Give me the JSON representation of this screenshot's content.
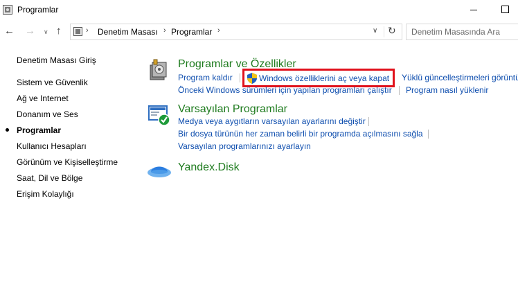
{
  "window": {
    "title": "Programlar"
  },
  "address": {
    "breadcrumbs": [
      "Denetim Masası",
      "Programlar"
    ],
    "search_placeholder": "Denetim Masasında Ara"
  },
  "sidebar": {
    "items": [
      {
        "label": "Denetim Masası Giriş",
        "active": false
      },
      {
        "label": "Sistem ve Güvenlik",
        "active": false
      },
      {
        "label": "Ağ ve Internet",
        "active": false
      },
      {
        "label": "Donanım ve Ses",
        "active": false
      },
      {
        "label": "Programlar",
        "active": true
      },
      {
        "label": "Kullanıcı Hesapları",
        "active": false
      },
      {
        "label": "Görünüm ve Kişiselleştirme",
        "active": false
      },
      {
        "label": "Saat, Dil ve Bölge",
        "active": false
      },
      {
        "label": "Erişim Kolaylığı",
        "active": false
      }
    ]
  },
  "categories": {
    "programs_features": {
      "title": "Programlar ve Özellikler",
      "links": {
        "uninstall": "Program kaldır",
        "windows_features": "Windows özelliklerini aç veya kapat",
        "installed_updates": "Yüklü güncelleştirmeleri görüntü",
        "older_programs": "Önceki Windows sürümleri için yapılan programları çalıştır",
        "how_to_install": "Program nasıl yüklenir"
      }
    },
    "default_programs": {
      "title": "Varsayılan Programlar",
      "links": {
        "media_autoplay": "Medya veya aygıtların varsayılan ayarlarını değiştir",
        "file_type": "Bir dosya türünün her zaman belirli bir programda açılmasını sağla",
        "set_defaults": "Varsayılan programlarınızı ayarlayın"
      }
    },
    "yandex_disk": {
      "title": "Yandex.Disk"
    }
  },
  "colors": {
    "category_title": "#1e7b1e",
    "link": "#0d4dae",
    "highlight_border": "#e0111b"
  }
}
